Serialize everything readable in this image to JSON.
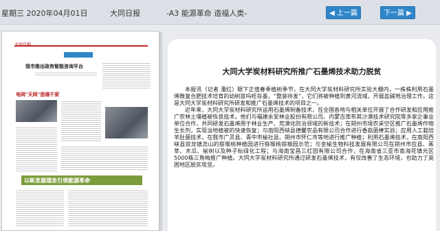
{
  "header": {
    "date": "星期三 2020年04月01日",
    "paper_name": "大同日报",
    "page_info": "-A3 能源革命 造福人类-",
    "prev_label": "◀ 上一篇",
    "next_label": "下一篇 ▶"
  },
  "thumbnail": {
    "masthead": "大同日报",
    "headline_1": "我市推出政务智能咨询平台",
    "headline_2": "电网\"天网\"造福千家",
    "banner_text": "以新发展理念引领能源革命"
  },
  "article": {
    "title": "大同大学炭材料研究所推广石墨烯技术助力脱贫",
    "paragraph_1": "本报讯（记者 潘红）眼下正值春季植树季节，在大同大学炭材料研究所实验大棚内，一株株利用石墨烯微复合肥技术培育的幼树苗吗旺存墨，“整装待发”，它们将被种植到黄河流域，开展盐碱地治理工作。这是大同大学炭材料研究所研发和推广石墨烯技术的项目之一。",
    "paragraph_2": "近年来，大同大学炭材料研究所运用石墨烯制备技术，在全国各地与相关单位开展了合作研发和应用推广农林土壤植被恢良技术。他们与福建永安林业股份有限公司、内蒙古库布其沙漠技术研究院等多家企事业单位合作，共同研发石墨烯用于林业生产、荒漠化防治领域的新技术；在朔州市境农采空区推广石墨烯作物生长剂，实现当地植被的快速恢复；与南阳西峡县德馨农品有限公司合作进行香菇菌棒实验；应用人工栽培羊肚菌技术，在我市广灵县、青中市榆社县、朔州市怀仁市等地进行推广种植；利用石墨烯技术，在南阳西峡县双龙镇尧山的猕猴桃种植园进行猕猴桃猕猴园示范；与金榆生物科技发展有限公司在朔州市应县、蒸莘、木瓜、榆树以及种子标绿化工程；与海南宝昌三红园有限公司合作，在海南省三亚市南海花镇元区5000株三角梅推广种植。大同大学炭材料研究所通过研发石墨烯技术，有仅改善了生态环境，也助力了英困地区脱贫攻坚。"
  },
  "colors": {
    "accent_blue": "#2f86c9",
    "masthead_red": "#b22222",
    "banner_green": "#7c9d3c"
  }
}
